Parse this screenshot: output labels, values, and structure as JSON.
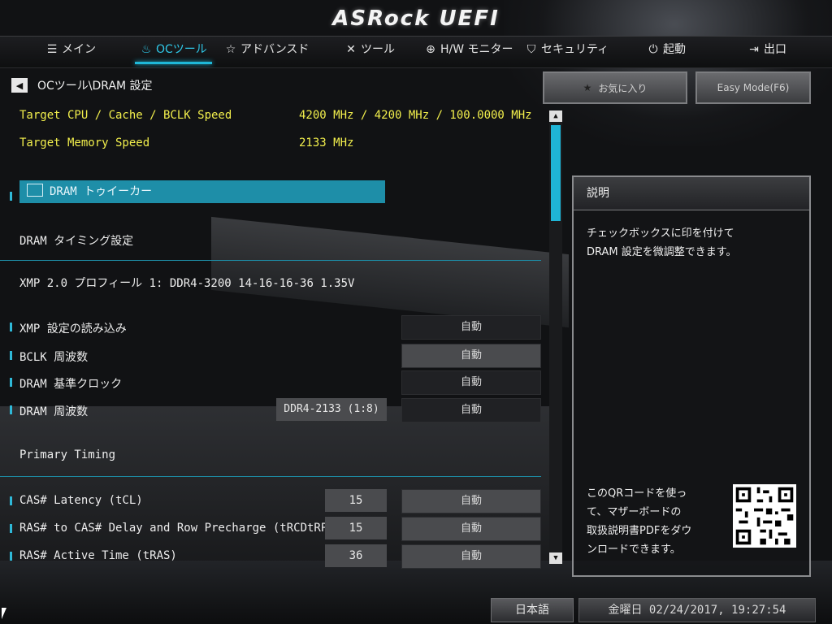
{
  "header": {
    "logo": "ASRock UEFI"
  },
  "nav": [
    {
      "label": "メイン",
      "icon": "list-icon"
    },
    {
      "label": "OCツール",
      "icon": "flame-icon",
      "active": true
    },
    {
      "label": "アドバンスド",
      "icon": "star-icon"
    },
    {
      "label": "ツール",
      "icon": "tools-icon"
    },
    {
      "label": "H/W モニター",
      "icon": "target-icon"
    },
    {
      "label": "セキュリティ",
      "icon": "shield-icon"
    },
    {
      "label": "起動",
      "icon": "power-icon"
    },
    {
      "label": "出口",
      "icon": "exit-icon"
    }
  ],
  "breadcrumb": "OCツール\\DRAM 設定",
  "buttons": {
    "favorites": "お気に入り",
    "easy_mode": "Easy Mode(F6)"
  },
  "info": {
    "target_cpu_label": "Target CPU / Cache / BCLK Speed",
    "target_cpu_value": "4200 MHz / 4200 MHz / 100.0000 MHz",
    "target_mem_label": "Target Memory Speed",
    "target_mem_value": "2133 MHz"
  },
  "submenu": "DRAM トゥイーカー",
  "sections": {
    "timing": "DRAM タイミング設定",
    "xmp_profile": "XMP 2.0 プロフィール 1: DDR4-3200 14-16-16-36 1.35V",
    "primary": "Primary Timing"
  },
  "settings": [
    {
      "label": "XMP 設定の読み込み",
      "value": "自動"
    },
    {
      "label": "BCLK 周波数",
      "value": "自動"
    },
    {
      "label": "DRAM 基準クロック",
      "value": "自動"
    },
    {
      "label": "DRAM 周波数",
      "value": "自動",
      "current": "DDR4-2133 (1:8)"
    }
  ],
  "timings": [
    {
      "label": "CAS# Latency (tCL)",
      "current": "15",
      "value": "自動"
    },
    {
      "label": "RAS# to CAS# Delay and Row Precharge (tRCDtRP)",
      "current": "15",
      "value": "自動"
    },
    {
      "label": "RAS# Active Time (tRAS)",
      "current": "36",
      "value": "自動"
    }
  ],
  "panel": {
    "title": "説明",
    "text": "チェックボックスに印を付けて\nDRAM 設定を微調整できます。",
    "qr_text": "このQRコードを使っ\nて、マザーボードの\n取扱説明書PDFをダウ\nンロードできます。"
  },
  "footer": {
    "language": "日本語",
    "datetime": "金曜日 02/24/2017, 19:27:54"
  }
}
